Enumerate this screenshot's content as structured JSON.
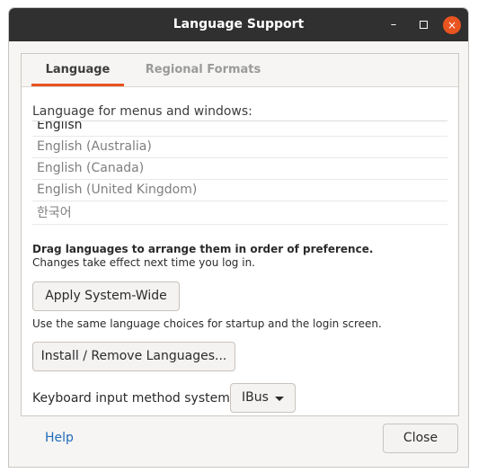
{
  "window": {
    "title": "Language Support"
  },
  "titlebar_buttons": {
    "minimize": "–",
    "close": "×"
  },
  "tabs": [
    {
      "label": "Language",
      "active": true
    },
    {
      "label": "Regional Formats",
      "active": false
    }
  ],
  "language_section": {
    "heading": "Language for menus and windows:",
    "languages": [
      "English",
      "English (Australia)",
      "English (Canada)",
      "English (United Kingdom)",
      "한국어"
    ],
    "drag_hint": "Drag languages to arrange them in order of preference.",
    "effect_hint": "Changes take effect next time you log in."
  },
  "apply": {
    "button_label": "Apply System-Wide",
    "note": "Use the same language choices for startup and the login screen."
  },
  "install": {
    "button_label": "Install / Remove Languages..."
  },
  "keyboard": {
    "label": "Keyboard input method system:",
    "selected": "IBus"
  },
  "footer": {
    "help_label": "Help",
    "close_label": "Close"
  },
  "colors": {
    "accent": "#e95420",
    "titlebar": "#303030",
    "link": "#1f6ab8"
  }
}
